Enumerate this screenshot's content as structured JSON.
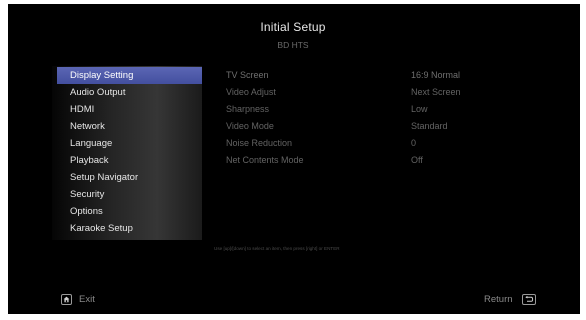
{
  "header": {
    "title": "Initial Setup",
    "subtitle": "BD HTS"
  },
  "sidebar": {
    "selected_index": 0,
    "items": [
      {
        "label": "Display Setting"
      },
      {
        "label": "Audio Output"
      },
      {
        "label": "HDMI"
      },
      {
        "label": "Network"
      },
      {
        "label": "Language"
      },
      {
        "label": "Playback"
      },
      {
        "label": "Setup Navigator"
      },
      {
        "label": "Security"
      },
      {
        "label": "Options"
      },
      {
        "label": "Karaoke Setup"
      }
    ]
  },
  "settings": {
    "rows": [
      {
        "label": "TV Screen",
        "value": "16:9 Normal"
      },
      {
        "label": "Video Adjust",
        "value": "Next Screen"
      },
      {
        "label": "Sharpness",
        "value": "Low"
      },
      {
        "label": "Video Mode",
        "value": "Standard"
      },
      {
        "label": "Noise Reduction",
        "value": "0"
      },
      {
        "label": "Net Contents Mode",
        "value": "Off"
      }
    ]
  },
  "hint": {
    "text": "Use [up]/[down] to select an item, then press [right] or ENTER"
  },
  "footer": {
    "exit_label": "Exit",
    "exit_icon": "home-icon",
    "return_label": "Return",
    "return_icon": "return-icon"
  },
  "colors": {
    "background": "#000000",
    "selected_item": "#4b57a9",
    "menu_text": "#e6e6e6",
    "inactive_text": "#636363"
  }
}
